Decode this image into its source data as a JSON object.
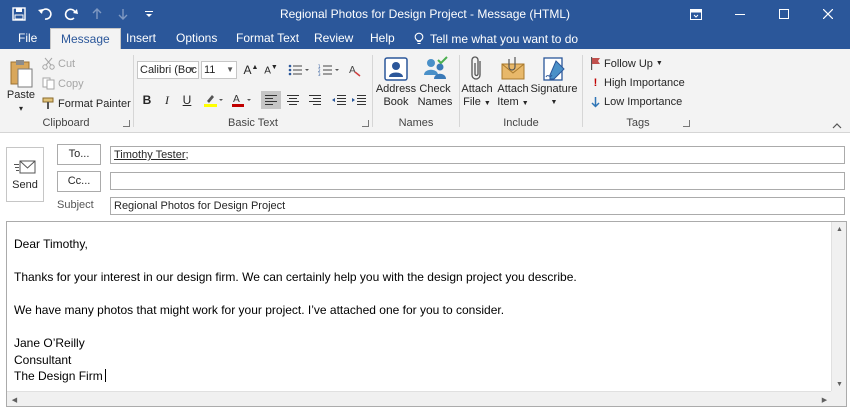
{
  "window": {
    "title": "Regional Photos for Design Project  -  Message (HTML)"
  },
  "tabs": [
    "File",
    "Message",
    "Insert",
    "Options",
    "Format Text",
    "Review",
    "Help"
  ],
  "tell_me": "Tell me what you want to do",
  "ribbon": {
    "clipboard": {
      "label": "Clipboard",
      "paste": "Paste",
      "cut": "Cut",
      "copy": "Copy",
      "format_painter": "Format Painter"
    },
    "basic_text": {
      "label": "Basic Text",
      "font_name": "Calibri (Boc",
      "font_size": "11"
    },
    "names": {
      "label": "Names",
      "address_book": [
        "Address",
        "Book"
      ],
      "check_names": [
        "Check",
        "Names"
      ]
    },
    "include": {
      "label": "Include",
      "attach_file": [
        "Attach",
        "File"
      ],
      "attach_item": [
        "Attach",
        "Item"
      ],
      "signature": "Signature"
    },
    "tags": {
      "label": "Tags",
      "follow_up": "Follow Up",
      "high_importance": "High Importance",
      "low_importance": "Low Importance"
    }
  },
  "header": {
    "send": "Send",
    "to_label": "To...",
    "to_value": "Timothy Tester",
    "to_suffix": ";",
    "cc_label": "Cc...",
    "cc_value": "",
    "subject_label": "Subject",
    "subject_value": "Regional Photos for Design Project"
  },
  "body": {
    "greeting": "Dear Timothy,",
    "para1": "Thanks for your interest in our design firm. We can certainly help you with the design project you describe.",
    "para2": "We have many photos that might work for your project. I’ve attached one for you to consider.",
    "sig_name": "Jane O’Reilly",
    "sig_title": "Consultant",
    "sig_company": "The Design Firm"
  },
  "colors": {
    "title_bar": "#2b579a",
    "ribbon": "#f3f3f3",
    "highlight": "#ffff00",
    "font_color": "#c00000",
    "follow_up_flag": "#c0504d",
    "high_importance": "#c00000",
    "low_importance": "#2e75b6"
  }
}
